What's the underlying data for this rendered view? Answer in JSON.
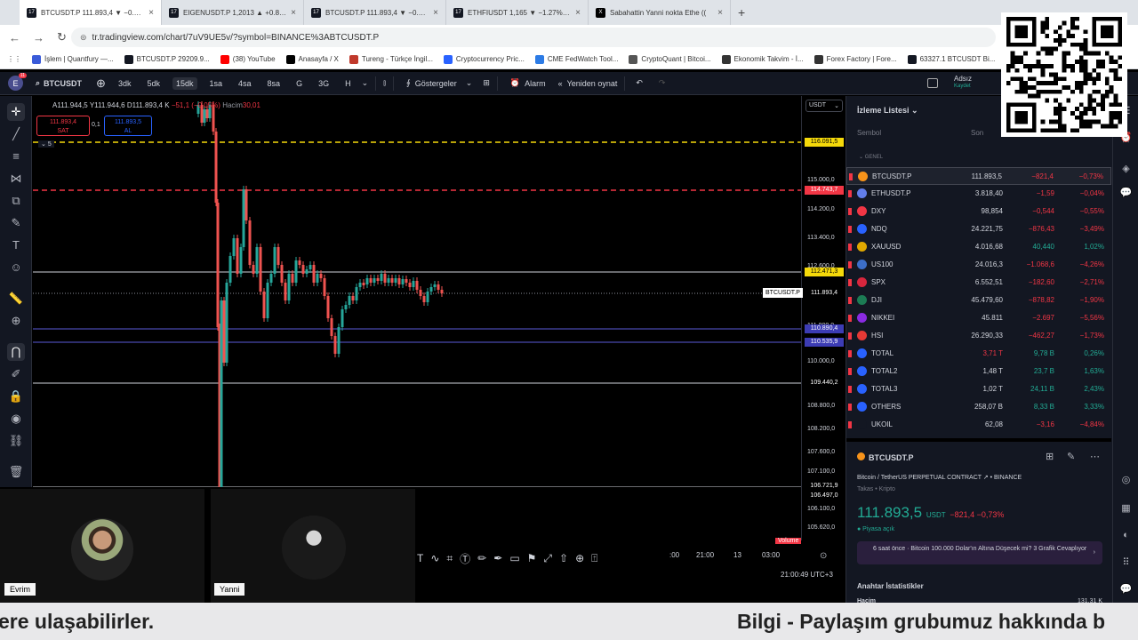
{
  "browser": {
    "tabs": [
      {
        "label": "BTCUSDT.P 111.893,4 ▼ −0.73%",
        "active": true
      },
      {
        "label": "EIGENUSDT.P 1,2013 ▲ +0.87%"
      },
      {
        "label": "BTCUSDT.P 111.893,4 ▼ −0.73%"
      },
      {
        "label": "ETHFIUSDT 1,165 ▼ −1.27% Ac"
      },
      {
        "label": "Sabahattin Yanni nokta Ethe (("
      }
    ],
    "url": "tr.tradingview.com/chart/7uV9UE5v/?symbol=BINANCE%3ABTCUSDT.P",
    "bookmarks": [
      {
        "label": "İşlem | Quantfury —...",
        "color": "#3a5bd9"
      },
      {
        "label": "BTCUSDT.P 29209.9...",
        "color": "#131722"
      },
      {
        "label": "(38) YouTube",
        "color": "#ff0000"
      },
      {
        "label": "Anasayfa / X",
        "color": "#000000"
      },
      {
        "label": "Tureng - Türkçe İngil...",
        "color": "#c0392b"
      },
      {
        "label": "Cryptocurrency Pric...",
        "color": "#2962ff"
      },
      {
        "label": "CME FedWatch Tool...",
        "color": "#2c7be5"
      },
      {
        "label": "CryptoQuant | Bitcoi...",
        "color": "#555555"
      },
      {
        "label": "Ekonomik Takvim - İ...",
        "color": "#333333"
      },
      {
        "label": "Forex Factory | Fore...",
        "color": "#333333"
      },
      {
        "label": "63327.1 BTCUSDT Bi...",
        "color": "#131722"
      }
    ]
  },
  "toolbar": {
    "avatar": "E",
    "badge": "11",
    "symbol": "BTCUSDT",
    "intervals": [
      "3dk",
      "5dk",
      "15dk",
      "1sa",
      "4sa",
      "8sa",
      "G",
      "3G",
      "H"
    ],
    "active_interval": "15dk",
    "indicators_label": "Göstergeler",
    "alarm_label": "Alarm",
    "replay_label": "Yeniden oynat",
    "account_name": "Adsız",
    "account_sub": "Kaydet"
  },
  "chart": {
    "ohlc_a": "A111.944,5",
    "ohlc_y": "Y111.944,6",
    "ohlc_d": "D111.893,4",
    "ohlc_k": "K",
    "ohlc_change": "−51,1 (−0,05%)",
    "volume_label": "Hacim",
    "volume_value": "30,01",
    "sell_price": "111.893,4",
    "sell_label": "SAT",
    "spread": "0,1",
    "buy_price": "111.893,5",
    "buy_label": "AL",
    "level_count": "5",
    "currency": "USDT",
    "last_symbol": "BTCUSDT.P",
    "price_labels": [
      "115.000,0",
      "114.200,0",
      "113.400,0",
      "112.600,0",
      "111.800,0",
      "110.000,0",
      "108.800,0",
      "108.200,0",
      "107.600,0",
      "107.100,0",
      "106.100,0",
      "105.620,0"
    ],
    "tags": [
      {
        "text": "116.091,5",
        "bg": "#f5d90a",
        "fg": "#000000"
      },
      {
        "text": "114.743,7",
        "bg": "#f23645",
        "fg": "#ffffff"
      },
      {
        "text": "112.471,3",
        "bg": "#f5d90a",
        "fg": "#000000"
      },
      {
        "text": "111.893,4",
        "bg": "#000000",
        "fg": "#ffffff"
      },
      {
        "text": "110.890,4",
        "bg": "#3c3cb4",
        "fg": "#ffffff"
      },
      {
        "text": "110.535,9",
        "bg": "#3c3cb4",
        "fg": "#ffffff"
      },
      {
        "text": "109.440,2",
        "bg": "#000000",
        "fg": "#ffffff"
      },
      {
        "text": "106.721,9",
        "bg": "#000000",
        "fg": "#ffffff"
      },
      {
        "text": "106.497,0",
        "bg": "#000000",
        "fg": "#ffffff"
      }
    ],
    "time_labels": [
      ":00",
      "21:00",
      "13",
      "03:00"
    ],
    "volume_badge": "Volume",
    "clock": "21:00:49 UTC+3"
  },
  "cams": [
    {
      "name": "Evrim"
    },
    {
      "name": "Yanni"
    }
  ],
  "watchlist": {
    "title": "İzleme Listesi",
    "col_symbol": "Sembol",
    "col_last": "Son",
    "section": "GENEL",
    "rows": [
      {
        "name": "BTCUSDT.P",
        "last": "111.893,5",
        "chg": "−821,4",
        "pct": "−0,73%",
        "icon": "#f7931a",
        "trend": "neg"
      },
      {
        "name": "ETHUSDT.P",
        "last": "3.818,40",
        "chg": "−1,59",
        "pct": "−0,04%",
        "icon": "#627eea",
        "trend": "neg"
      },
      {
        "name": "DXY",
        "last": "98,854",
        "chg": "−0,544",
        "pct": "−0,55%",
        "icon": "#f23645",
        "trend": "neg"
      },
      {
        "name": "NDQ",
        "last": "24.221,75",
        "chg": "−876,43",
        "pct": "−3,49%",
        "icon": "#2962ff",
        "trend": "neg"
      },
      {
        "name": "XAUUSD",
        "last": "4.016,68",
        "chg": "40,440",
        "pct": "1,02%",
        "icon": "#e0a800",
        "trend": "pos"
      },
      {
        "name": "US100",
        "last": "24.016,3",
        "chg": "−1.068,6",
        "pct": "−4,26%",
        "icon": "#3c6ec8",
        "trend": "neg"
      },
      {
        "name": "SPX",
        "last": "6.552,51",
        "chg": "−182,60",
        "pct": "−2,71%",
        "icon": "#d7263d",
        "trend": "neg"
      },
      {
        "name": "DJI",
        "last": "45.479,60",
        "chg": "−878,82",
        "pct": "−1,90%",
        "icon": "#1c7c54",
        "trend": "neg"
      },
      {
        "name": "NIKKEI",
        "last": "45.811",
        "chg": "−2.697",
        "pct": "−5,56%",
        "icon": "#8a2be2",
        "trend": "neg"
      },
      {
        "name": "HSI",
        "last": "26.290,33",
        "chg": "−462,27",
        "pct": "−1,73%",
        "icon": "#e53935",
        "trend": "neg"
      },
      {
        "name": "TOTAL",
        "last": "3,71 T",
        "chg": "9,78 B",
        "pct": "0,26%",
        "icon": "#2962ff",
        "trend": "pos",
        "last_color": "#f23645"
      },
      {
        "name": "TOTAL2",
        "last": "1,48 T",
        "chg": "23,7 B",
        "pct": "1,63%",
        "icon": "#2962ff",
        "trend": "pos"
      },
      {
        "name": "TOTAL3",
        "last": "1,02 T",
        "chg": "24,11 B",
        "pct": "2,43%",
        "icon": "#2962ff",
        "trend": "pos"
      },
      {
        "name": "OTHERS",
        "last": "258,07 B",
        "chg": "8,33 B",
        "pct": "3,33%",
        "icon": "#2962ff",
        "trend": "pos"
      },
      {
        "name": "UKOIL",
        "last": "62,08",
        "chg": "−3,16",
        "pct": "−4,84%",
        "icon": "#131722",
        "trend": "neg"
      }
    ]
  },
  "detail": {
    "symbol": "BTCUSDT.P",
    "full_name": "Bitcoin / TetherUS PERPETUAL CONTRACT  ↗ • BINANCE",
    "category": "Takas • Kripto",
    "price": "111.893,5",
    "unit": "USDT",
    "change": "−821,4  −0,73%",
    "status": "● Piyasa açık",
    "news": "6 saat önce · Bitcoin 100.000 Dolar'ın Altına Düşecek mi? 3 Grafik Cevaplıyor",
    "stats_title": "Anahtar İstatistikler",
    "volume_label": "Hacim",
    "volume_value": "131,31 K"
  },
  "ticker": {
    "left": "ere ulaşabilirler.",
    "right": "Bilgi - Paylaşım grubumuz hakkında b"
  }
}
